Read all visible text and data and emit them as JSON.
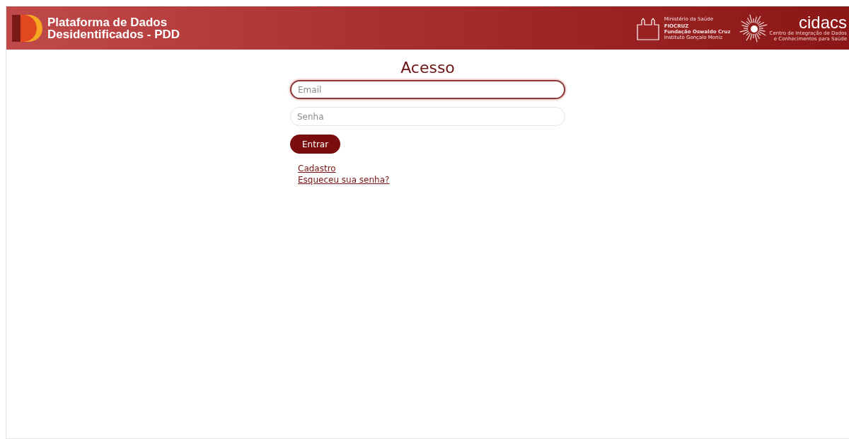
{
  "header": {
    "title_line_1": "Plataforma de Dados",
    "title_line_2": "Desidentificados - PDD",
    "partner_logo": {
      "ministry": "Ministério da Saúde",
      "org": "FIOCRUZ",
      "foundation": "Fundação Oswaldo Cruz",
      "institute": "Instituto Gonçalo Moniz"
    },
    "cidacs_logo": {
      "name": "cidacs",
      "line_1": "Centro de Integração de Dados",
      "line_2": "e Conhecimentos para Saúde"
    }
  },
  "login": {
    "title": "Acesso",
    "fields": [
      {
        "placeholder": "Email",
        "focused": true
      },
      {
        "placeholder": "Senha",
        "focused": false
      }
    ],
    "submit": "Entrar",
    "links": [
      "Cadastro",
      "Esqueceu sua senha?"
    ]
  }
}
